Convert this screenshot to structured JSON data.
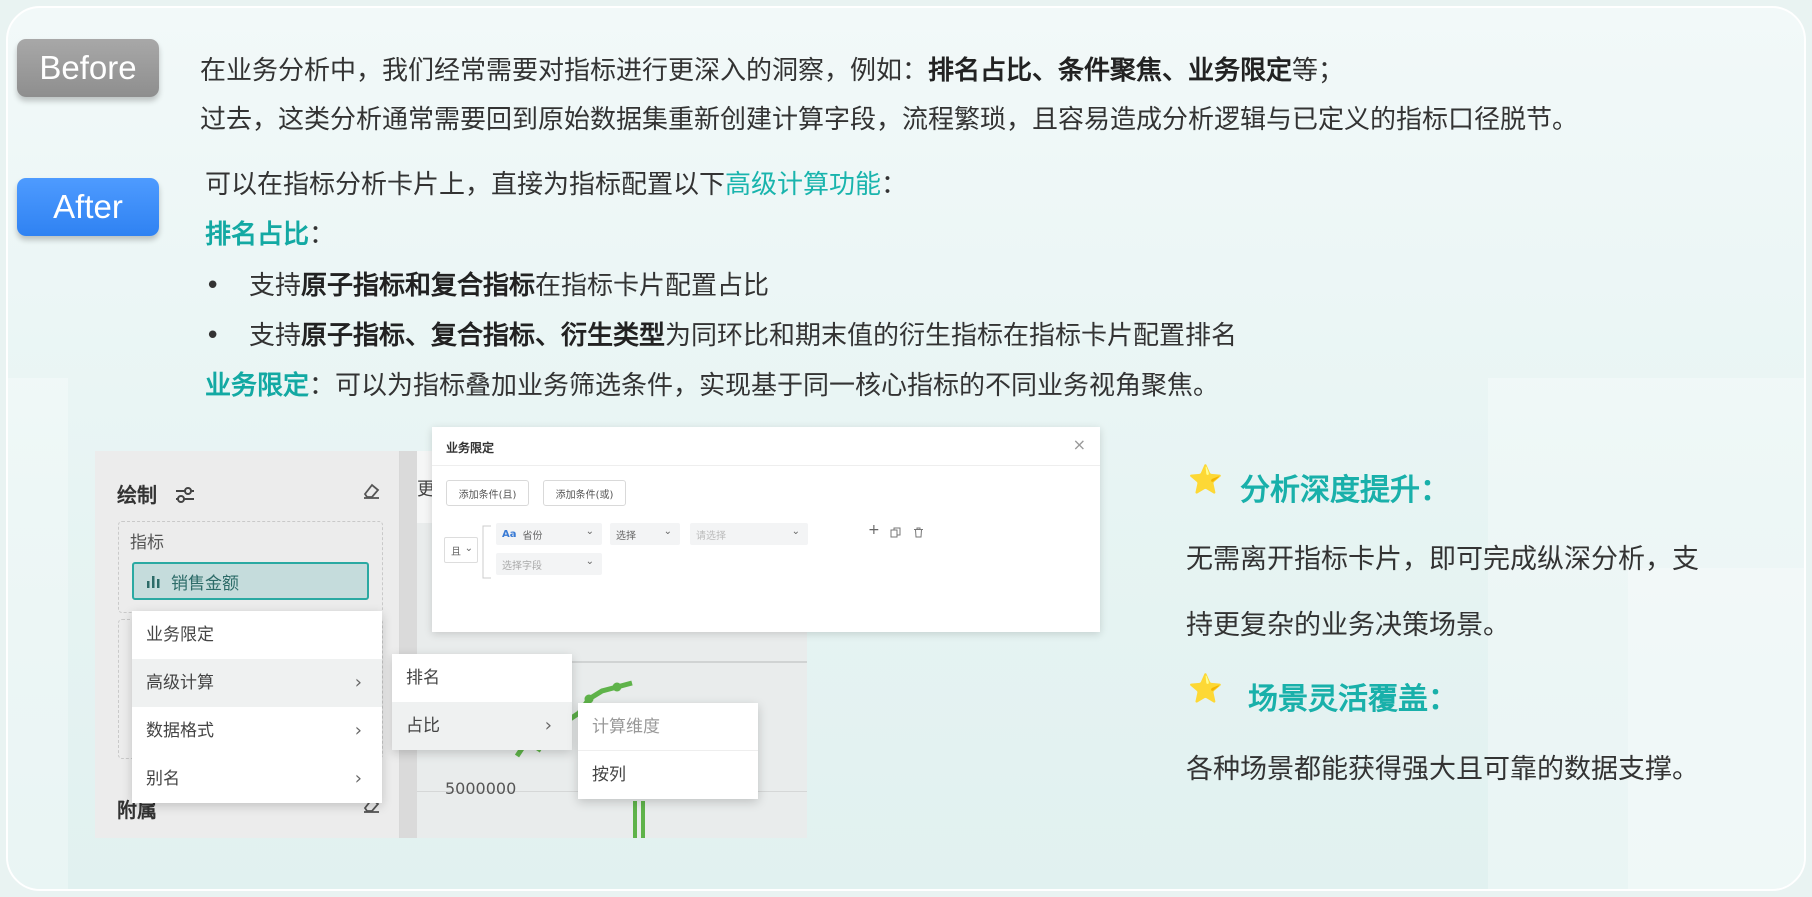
{
  "badges": {
    "before": "Before",
    "after": "After"
  },
  "before": {
    "line1_pre": "在业务分析中，我们经常需要对指标进行更深入的洞察，例如：",
    "line1_bold": "排名占比、条件聚焦、业务限定",
    "line1_post": "等；",
    "line2": "过去，这类分析通常需要回到原始数据集重新创建计算字段，流程繁琐，且容易造成分析逻辑与已定义的指标口径脱节。"
  },
  "after": {
    "intro_pre": "可以在指标分析卡片上，直接为指标配置以下",
    "intro_link": "高级计算功能",
    "intro_post": "：",
    "rank_heading": "排名占比",
    "rank_colon": "：",
    "bullets": [
      {
        "dot": "•",
        "pre": "支持",
        "bold": "原子指标和复合指标",
        "post": "在指标卡片配置占比"
      },
      {
        "dot": "•",
        "pre": "支持",
        "bold": "原子指标、复合指标、衍生类型",
        "post": "为同环比和期末值的衍生指标在指标卡片配置排名"
      }
    ],
    "limit_heading": "业务限定",
    "limit_text": "：可以为指标叠加业务筛选条件，实现基于同一核心指标的不同业务视角聚焦。"
  },
  "screenshot": {
    "draw_title": "绘制",
    "field_label": "指标",
    "metric_name": "销售金额",
    "attach_title": "附属",
    "cut_text": "更",
    "axis_value": "5000000",
    "menu": [
      {
        "label": "业务限定",
        "arrow": ""
      },
      {
        "label": "高级计算",
        "arrow": "›"
      },
      {
        "label": "数据格式",
        "arrow": "›"
      },
      {
        "label": "别名",
        "arrow": "›"
      }
    ],
    "submenu": [
      {
        "label": "排名",
        "arrow": ""
      },
      {
        "label": "占比",
        "arrow": "›"
      }
    ],
    "submenu2": [
      "计算维度",
      "按列"
    ]
  },
  "dialog": {
    "title": "业务限定",
    "close": "×",
    "add_and": "添加条件(且)",
    "add_or": "添加条件(或)",
    "logic": "且",
    "field_icon": "Aa",
    "field": "省份",
    "operator": "选择",
    "value_placeholder": "请选择",
    "field2_placeholder": "选择字段"
  },
  "highlights": [
    {
      "star": "⭐",
      "title": "分析深度提升：",
      "lines": [
        "无需离开指标卡片，即可完成纵深分析，支",
        "持更复杂的业务决策场景。"
      ]
    },
    {
      "star": "⭐",
      "title": "场景灵活覆盖：",
      "lines": [
        "各种场景都能获得强大且可靠的数据支撑。"
      ]
    }
  ],
  "colors": {
    "teal": "#19b4ad",
    "before_badge": "#9a9a9a",
    "after_badge": "#3a8cf7"
  }
}
